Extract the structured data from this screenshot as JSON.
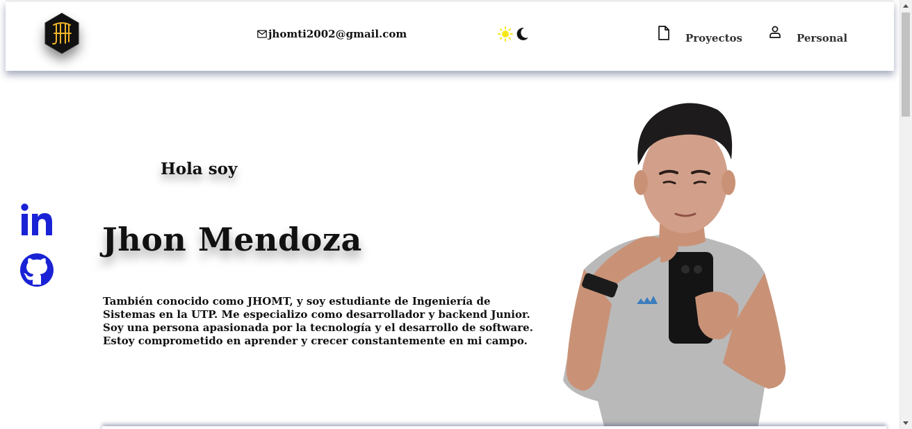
{
  "header": {
    "logo_text": "JH",
    "email": "jhomti2002@gmail.com",
    "nav": [
      {
        "label": "Proyectos",
        "icon": "document-icon"
      },
      {
        "label": "Personal",
        "icon": "user-icon"
      }
    ],
    "theme_icons": [
      "sun-icon",
      "moon-icon"
    ]
  },
  "social": [
    {
      "name": "linkedin",
      "label": "in",
      "icon": "linkedin-icon"
    },
    {
      "name": "github",
      "icon": "github-icon"
    }
  ],
  "hero": {
    "greeting": "Hola soy",
    "name": "Jhon Mendoza",
    "bio": "También conocido como JHOMT, y soy estudiante de Ingeniería de Sistemas en la UTP. Me especializo como desarrollador y backend Junior. Soy una persona apasionada por la tecnología y el desarrollo de software. Estoy comprometido en aprender y crecer constantemente en mi campo."
  },
  "colors": {
    "accent_blue": "#1a22d6",
    "logo_gold": "#f0b62a",
    "sun_yellow": "#f7e81a",
    "header_shadow": "#3c466e"
  }
}
